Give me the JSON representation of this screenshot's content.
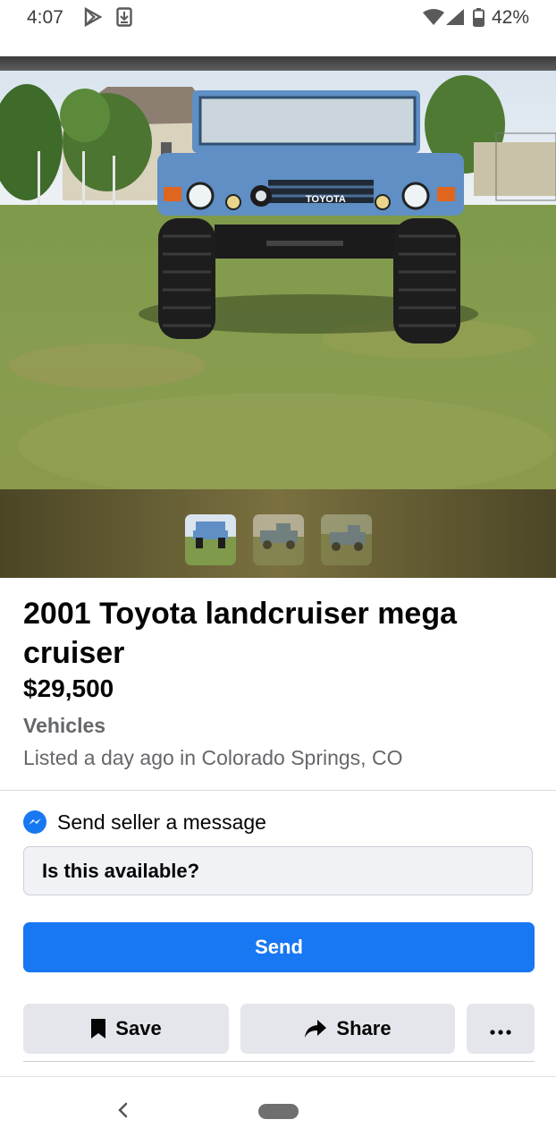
{
  "status_bar": {
    "time": "4:07",
    "battery": "42%"
  },
  "listing": {
    "title": "2001 Toyota landcruiser mega cruiser",
    "price": "$29,500",
    "category": "Vehicles",
    "listed": "Listed a day ago in Colorado Springs, CO",
    "vehicle_badge": "TOYOTA"
  },
  "message": {
    "label": "Send seller a message",
    "input_value": "Is this available?"
  },
  "buttons": {
    "send": "Send",
    "save": "Save",
    "share": "Share"
  },
  "colors": {
    "accent": "#1877f2",
    "button_grey": "#e4e6eb",
    "truck_blue": "#5f8fc4"
  }
}
